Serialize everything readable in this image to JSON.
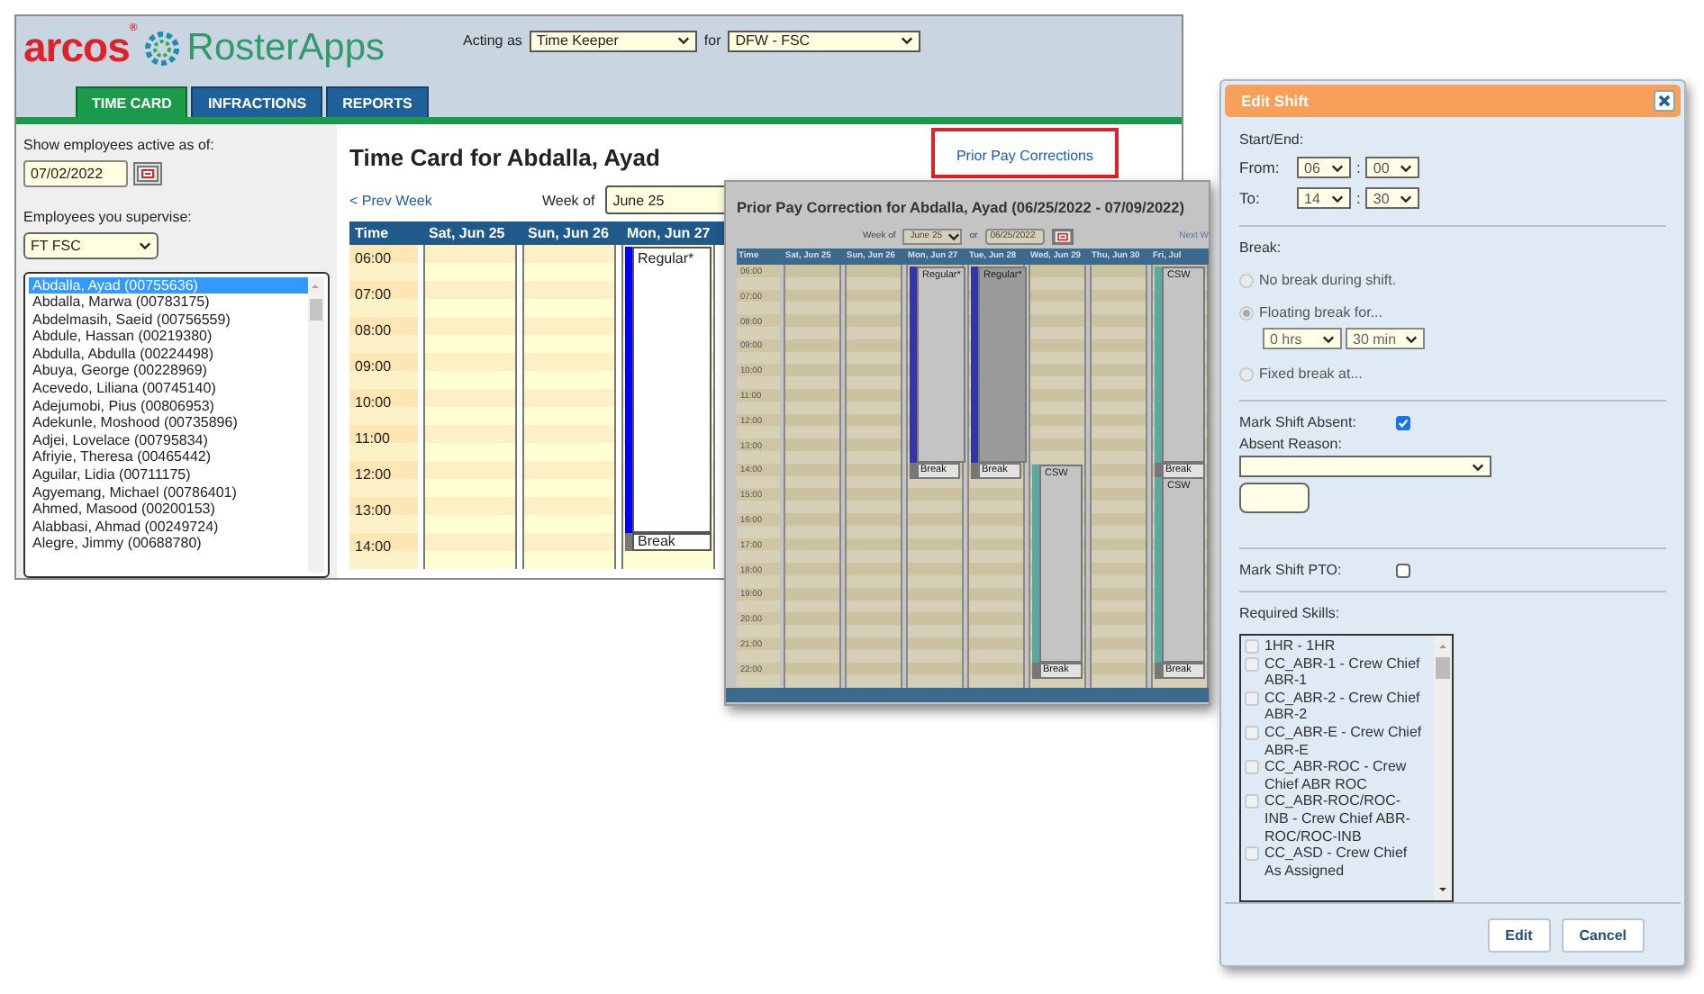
{
  "main_window": {
    "logo": {
      "brand": "arcos$^{®}$",
      "product": "RosterApps"
    },
    "acting_as": {
      "label": "Acting as",
      "value": "Time Keeper"
    },
    "location": {
      "label": "for",
      "value": "DFW - FSC"
    },
    "tabs": [
      {
        "label": "TIME CARD",
        "selected": true
      },
      {
        "label": "INFRACTIONS",
        "selected": false
      },
      {
        "label": "REPORTS",
        "selected": false
      }
    ],
    "sidebar": {
      "active_as_of_label": "Show employees active as of:",
      "active_as_of_value": "07/02/2022",
      "supervise_label": "Employees you supervise:",
      "group": "FT FSC",
      "employees": [
        {
          "name": "Abdalla, Ayad (00755636)",
          "selected": true
        },
        {
          "name": "Abdalla, Marwa (00783175)",
          "selected": false
        },
        {
          "name": "Abdelmasih, Saeid (00756559)",
          "selected": false
        },
        {
          "name": "Abdule, Hassan (00219380)",
          "selected": false
        },
        {
          "name": "Abdulla, Abdulla (00224498)",
          "selected": false
        },
        {
          "name": "Abuya, George (00228969)",
          "selected": false
        },
        {
          "name": "Acevedo, Liliana (00745140)",
          "selected": false
        },
        {
          "name": "Adejumobi, Pius (00806953)",
          "selected": false
        },
        {
          "name": "Adekunle, Moshood (00735896)",
          "selected": false
        },
        {
          "name": "Adjei, Lovelace (00795834)",
          "selected": false
        },
        {
          "name": "Afriyie, Theresa (00465442)",
          "selected": false
        },
        {
          "name": "Aguilar, Lidia (00711175)",
          "selected": false
        },
        {
          "name": "Agyemang, Michael (00786401)",
          "selected": false
        },
        {
          "name": "Ahmed, Masood (00200153)",
          "selected": false
        },
        {
          "name": "Alabbasi, Ahmad (00249724)",
          "selected": false
        },
        {
          "name": "Alegre, Jimmy (00688780)",
          "selected": false
        }
      ]
    },
    "time_card": {
      "title": "Time Card for Abdalla, Ayad",
      "prior_pay_link": "Prior Pay Corrections",
      "prev_week": "< Prev Week",
      "week_of_label": "Week of",
      "week_of_value": "June 25",
      "grid": {
        "time_header": "Time",
        "times": [
          "06:00",
          "07:00",
          "08:00",
          "09:00",
          "10:00",
          "11:00",
          "12:00",
          "13:00",
          "14:00"
        ],
        "days": [
          {
            "label": "Sat, Jun 25"
          },
          {
            "label": "Sun, Jun 26"
          },
          {
            "label": "Mon, Jun 27",
            "shifts": [
              {
                "label": "Regular*",
                "kind": "morning",
                "color": "#0000ff",
                "selected": false,
                "break": "Break"
              }
            ]
          }
        ]
      }
    }
  },
  "prior_pay_popup": {
    "title": "Prior Pay Correction for Abdalla, Ayad (06/25/2022 - 07/09/2022)",
    "week_of_label": "Week of",
    "week_of_value": "June 25",
    "or_label": "or",
    "date_value": "06/25/2022",
    "next_week": "Next W",
    "grid": {
      "time_header": "Time",
      "times": [
        "06:00",
        "07:00",
        "08:00",
        "09:00",
        "10:00",
        "11:00",
        "12:00",
        "13:00",
        "14:00",
        "15:00",
        "16:00",
        "17:00",
        "18:00",
        "19:00",
        "20:00",
        "21:00",
        "22:00"
      ],
      "days": [
        {
          "label": "Sat, Jun 25"
        },
        {
          "label": "Sun, Jun 26"
        },
        {
          "label": "Mon, Jun 27",
          "shifts": [
            {
              "label": "Regular*",
              "kind": "morning",
              "color": "#3333aa",
              "selected": false,
              "break": "Break"
            }
          ]
        },
        {
          "label": "Tue, Jun 28",
          "shifts": [
            {
              "label": "Regular*",
              "kind": "morning",
              "color": "#3333aa",
              "selected": true,
              "break": "Break"
            }
          ]
        },
        {
          "label": "Wed, Jun 29",
          "shifts": [
            {
              "label": "CSW",
              "kind": "evening",
              "color": "#5aa8a0",
              "selected": false,
              "break": "Break"
            }
          ]
        },
        {
          "label": "Thu, Jun 30"
        },
        {
          "label": "Fri, Jul",
          "shifts": [
            {
              "label": "CSW",
              "kind": "morning",
              "color": "#5aa8a0",
              "selected": false,
              "break": "Break"
            },
            {
              "label": "CSW",
              "kind": "late",
              "color": "#5aa8a0",
              "selected": false,
              "break": "Break"
            }
          ]
        }
      ]
    }
  },
  "edit_shift": {
    "title": "Edit Shift",
    "start_end_label": "Start/End:",
    "times": [
      {
        "label": "From:",
        "hour": "06",
        "separator": ":",
        "minute": "00"
      },
      {
        "label": "To:",
        "hour": "14",
        "separator": ":",
        "minute": "30"
      }
    ],
    "break_label": "Break:",
    "break_options": [
      {
        "label": "No break during shift.",
        "selected": false
      },
      {
        "label": "Floating break for...",
        "selected": true
      },
      {
        "label": "Fixed break at...",
        "selected": false
      }
    ],
    "float_hours": "0 hrs",
    "float_minutes": "30 min",
    "absent": {
      "label": "Mark Shift Absent:",
      "checked": true
    },
    "absent_reason_label": "Absent Reason:",
    "pto": {
      "label": "Mark Shift PTO:",
      "checked": false
    },
    "skills_label": "Required Skills:",
    "skills": [
      {
        "label": "1HR - 1HR",
        "checked": false
      },
      {
        "label": "CC_ABR-1 - Crew Chief ABR-1",
        "checked": false
      },
      {
        "label": "CC_ABR-2 - Crew Chief ABR-2",
        "checked": false
      },
      {
        "label": "CC_ABR-E - Crew Chief ABR-E",
        "checked": false
      },
      {
        "label": "CC_ABR-ROC - Crew Chief ABR ROC",
        "checked": false
      },
      {
        "label": "CC_ABR-ROC/ROC-INB - Crew Chief ABR-ROC/ROC-INB",
        "checked": false
      },
      {
        "label": "CC_ASD - Crew Chief As Assigned",
        "checked": false
      }
    ],
    "buttons": [
      "Edit",
      "Cancel"
    ]
  }
}
